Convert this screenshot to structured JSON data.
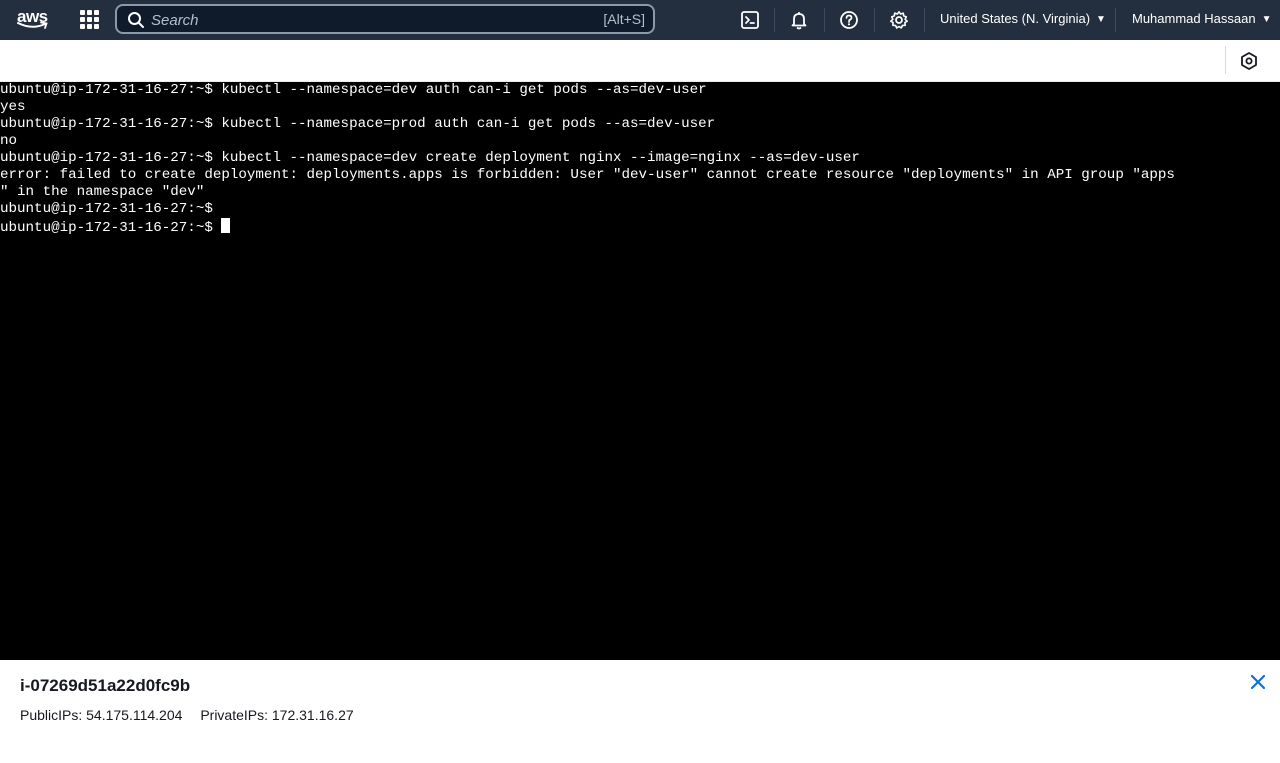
{
  "nav": {
    "logo_text": "aws",
    "search_placeholder": "Search",
    "search_shortcut": "[Alt+S]",
    "region": "United States (N. Virginia)",
    "user": "Muhammad Hassaan",
    "icons": [
      "cloudshell-icon",
      "bell-icon",
      "help-icon",
      "gear-icon"
    ]
  },
  "terminal": {
    "lines": [
      "ubuntu@ip-172-31-16-27:~$ kubectl --namespace=dev auth can-i get pods --as=dev-user",
      "yes",
      "ubuntu@ip-172-31-16-27:~$ kubectl --namespace=prod auth can-i get pods --as=dev-user",
      "no",
      "ubuntu@ip-172-31-16-27:~$ kubectl --namespace=dev create deployment nginx --image=nginx --as=dev-user",
      "error: failed to create deployment: deployments.apps is forbidden: User \"dev-user\" cannot create resource \"deployments\" in API group \"apps",
      "\" in the namespace \"dev\"",
      "ubuntu@ip-172-31-16-27:~$",
      "ubuntu@ip-172-31-16-27:~$ "
    ]
  },
  "instance": {
    "id": "i-07269d51a22d0fc9b",
    "public_ips": "PublicIPs: 54.175.114.204",
    "private_ips": "PrivateIPs: 172.31.16.27"
  },
  "colors": {
    "nav_bg": "#232f3e",
    "terminal_bg": "#000000",
    "accent_blue": "#0972d3"
  }
}
